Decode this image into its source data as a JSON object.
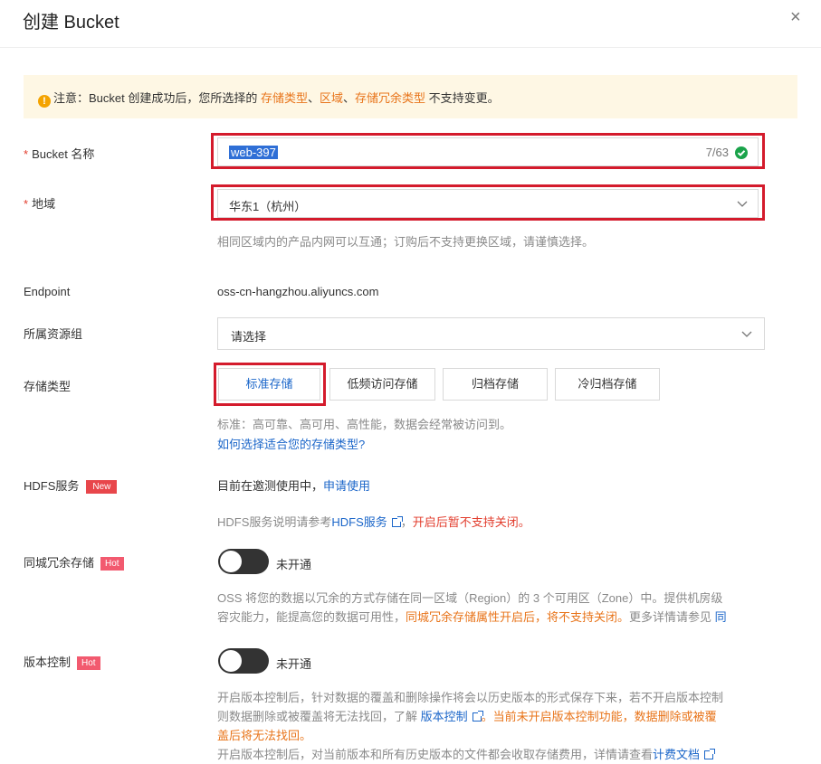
{
  "dialog": {
    "title": "创建 Bucket",
    "close_icon": "×"
  },
  "notice": {
    "prefix": "注意：Bucket 创建成功后，您所选择的 ",
    "hl1": "存储类型",
    "sep1": "、",
    "hl2": "区域",
    "sep2": "、",
    "hl3": "存储冗余类型",
    "suffix": " 不支持变更。"
  },
  "bucket_name": {
    "required": "*",
    "label": "Bucket 名称",
    "value": "web-397",
    "counter": "7/63"
  },
  "region": {
    "required": "*",
    "label": "地域",
    "value": "华东1（杭州）",
    "help": "相同区域内的产品内网可以互通；订购后不支持更换区域，请谨慎选择。"
  },
  "endpoint": {
    "label": "Endpoint",
    "value": "oss-cn-hangzhou.aliyuncs.com"
  },
  "resource_group": {
    "label": "所属资源组",
    "placeholder": "请选择"
  },
  "storage_class": {
    "label": "存储类型",
    "options": [
      "标准存储",
      "低频访问存储",
      "归档存储",
      "冷归档存储"
    ],
    "help": "标准：高可靠、高可用、高性能，数据会经常被访问到。",
    "link": "如何选择适合您的存储类型?"
  },
  "hdfs": {
    "label": "HDFS服务",
    "badge": "New",
    "status": "目前在邀测使用中，",
    "apply_link": "申请使用",
    "note_prefix": "HDFS服务说明请参考",
    "note_link": "HDFS服务",
    "note_sep": "，",
    "note_red": "开启后暂不支持关闭。"
  },
  "zrs": {
    "label": "同城冗余存储",
    "badge": "Hot",
    "toggle_text": "未开通",
    "desc1": "OSS 将您的数据以冗余的方式存储在同一区域（Region）的 3 个可用区（Zone）中。提供机房级",
    "desc2_a": "容灾能力，能提高您的数据可用性，",
    "desc2_orange": "同城冗余存储属性开启后，将不支持关闭。",
    "desc2_b": "更多详情请参见 ",
    "desc2_link": "同"
  },
  "versioning": {
    "label": "版本控制",
    "badge": "Hot",
    "toggle_text": "未开通",
    "desc1": "开启版本控制后，针对数据的覆盖和删除操作将会以历史版本的形式保存下来，若不开启版本控制",
    "desc2_a": "则数据删除或被覆盖将无法找回，了解 ",
    "desc2_link": "版本控制",
    "desc2_orange": "。当前未开启版本控制功能，数据删除或被覆",
    "desc3_orange": "盖后将无法找回。",
    "desc4_a": "开启版本控制后，对当前版本和所有历史版本的文件都会收取存储费用，详情请查看",
    "desc4_link": "计费文档"
  },
  "colors": {
    "required": "#e23c2c",
    "link": "#1b66c9",
    "warning": "#e8741a",
    "highlight": "#d41b2c",
    "success": "#1aa34a"
  }
}
